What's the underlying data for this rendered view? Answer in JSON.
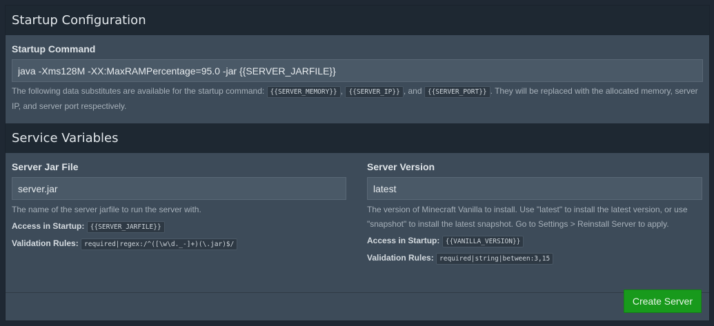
{
  "startup": {
    "title": "Startup Configuration",
    "command_label": "Startup Command",
    "command_value": "java -Xms128M -XX:MaxRAMPercentage=95.0 -jar {{SERVER_JARFILE}}",
    "help_prefix": "The following data substitutes are available for the startup command: ",
    "var_memory": "{{SERVER_MEMORY}}",
    "sep1": ", ",
    "var_ip": "{{SERVER_IP}}",
    "sep2": ", and ",
    "var_port": "{{SERVER_PORT}}",
    "help_suffix": ". They will be replaced with the allocated memory, server IP, and server port respectively."
  },
  "variables": {
    "title": "Service Variables",
    "items": [
      {
        "label": "Server Jar File",
        "value": "server.jar",
        "description": "The name of the server jarfile to run the server with.",
        "access_label": "Access in Startup:",
        "access_value": "{{SERVER_JARFILE}}",
        "rules_label": "Validation Rules:",
        "rules_value": "required|regex:/^([\\w\\d._-]+)(\\.jar)$/"
      },
      {
        "label": "Server Version",
        "value": "latest",
        "description": "The version of Minecraft Vanilla to install. Use \"latest\" to install the latest version, or use \"snapshot\" to install the latest snapshot. Go to Settings > Reinstall Server to apply.",
        "access_label": "Access in Startup:",
        "access_value": "{{VANILLA_VERSION}}",
        "rules_label": "Validation Rules:",
        "rules_value": "required|string|between:3,15"
      }
    ]
  },
  "footer": {
    "create_label": "Create Server"
  }
}
